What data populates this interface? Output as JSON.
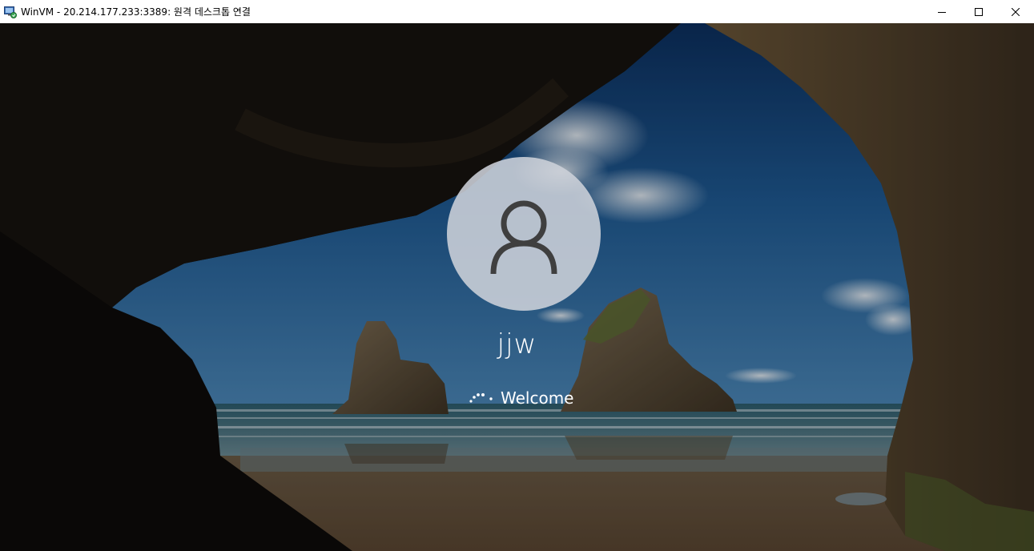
{
  "window": {
    "title": "WinVM - 20.214.177.233:3389: 원격 데스크톱 연결",
    "icon": "remote-desktop-icon",
    "controls": {
      "minimize_icon": "minimize-icon",
      "maximize_icon": "maximize-icon",
      "close_icon": "close-icon"
    }
  },
  "lock_screen": {
    "avatar_icon": "user-icon",
    "username": "jjw",
    "status_text": "Welcome",
    "spinner_icon": "loading-spinner-icon"
  }
}
